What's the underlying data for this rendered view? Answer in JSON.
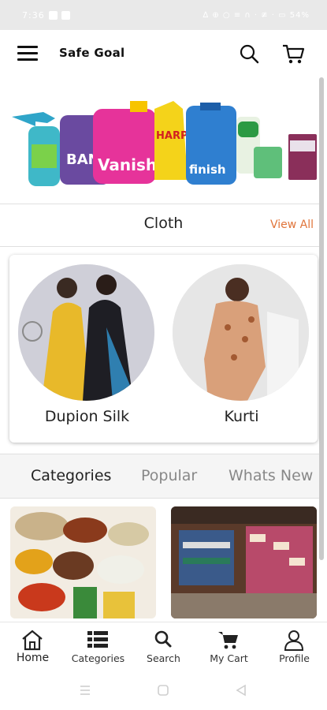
{
  "status_bar": {
    "time": "7:36",
    "right_text": "∆ ⊕ ○ ≡ ∩ · ≇ · ▭ 54%"
  },
  "app_bar": {
    "title": "Safe Goal",
    "menu_icon": "hamburger-menu-icon",
    "search_icon": "search-icon",
    "cart_icon": "cart-icon"
  },
  "banner": {
    "brands": [
      "BAN",
      "Vanish",
      "HARPIC",
      "finish"
    ]
  },
  "cloth_section": {
    "title": "Cloth",
    "view_all": "View All",
    "items": [
      {
        "label": "Dupion Silk"
      },
      {
        "label": "Kurti"
      }
    ]
  },
  "tabs": [
    {
      "label": "Categories",
      "active": true
    },
    {
      "label": "Popular",
      "active": false
    },
    {
      "label": "Whats New",
      "active": false
    }
  ],
  "bottom_nav": [
    {
      "label": "Home",
      "icon": "home-icon",
      "active": true
    },
    {
      "label": "Categories",
      "icon": "categories-icon",
      "active": false
    },
    {
      "label": "Search",
      "icon": "search-icon",
      "active": false
    },
    {
      "label": "My Cart",
      "icon": "cart-icon",
      "active": false
    },
    {
      "label": "Profile",
      "icon": "profile-icon",
      "active": false
    }
  ],
  "colors": {
    "accent": "#e0743a",
    "text": "#222222",
    "tab_inactive": "#888888"
  }
}
